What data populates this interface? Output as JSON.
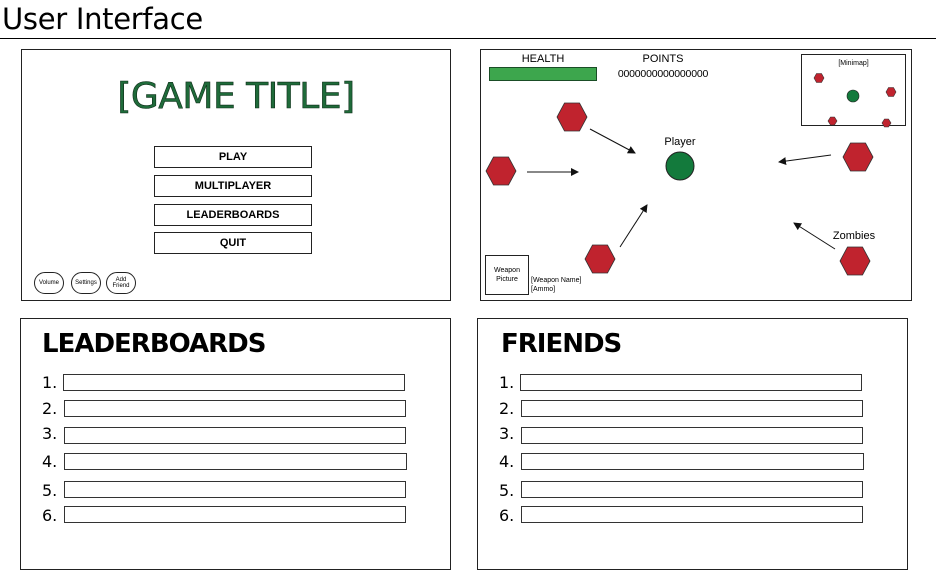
{
  "page": {
    "title": "User Interface"
  },
  "main_menu": {
    "game_title": "[GAME TITLE]",
    "buttons": [
      "PLAY",
      "MULTIPLAYER",
      "LEADERBOARDS",
      "QUIT"
    ],
    "pills": {
      "volume": "Volume",
      "settings": "Settings",
      "add_friend": "Add Friend"
    }
  },
  "gameplay": {
    "health_label": "HEALTH",
    "points_label": "POINTS",
    "points_value": "0000000000000000",
    "health_fill": 1.0,
    "minimap_label": "[Minimap]",
    "player_label": "Player",
    "zombies_label": "Zombies",
    "weapon_picture": "Weapon Picture",
    "weapon_name": "[Weapon Name]",
    "ammo": "[Ammo]",
    "colors": {
      "zombie": "#c0232e",
      "player": "#137a3c",
      "health": "#3da64d"
    }
  },
  "leaderboards": {
    "title": "LEADERBOARDS",
    "rows": [
      "1.",
      "2.",
      "3.",
      "4.",
      "5.",
      "6."
    ]
  },
  "friends": {
    "title": "FRIENDS",
    "rows": [
      "1.",
      "2.",
      "3.",
      "4.",
      "5.",
      "6."
    ]
  }
}
